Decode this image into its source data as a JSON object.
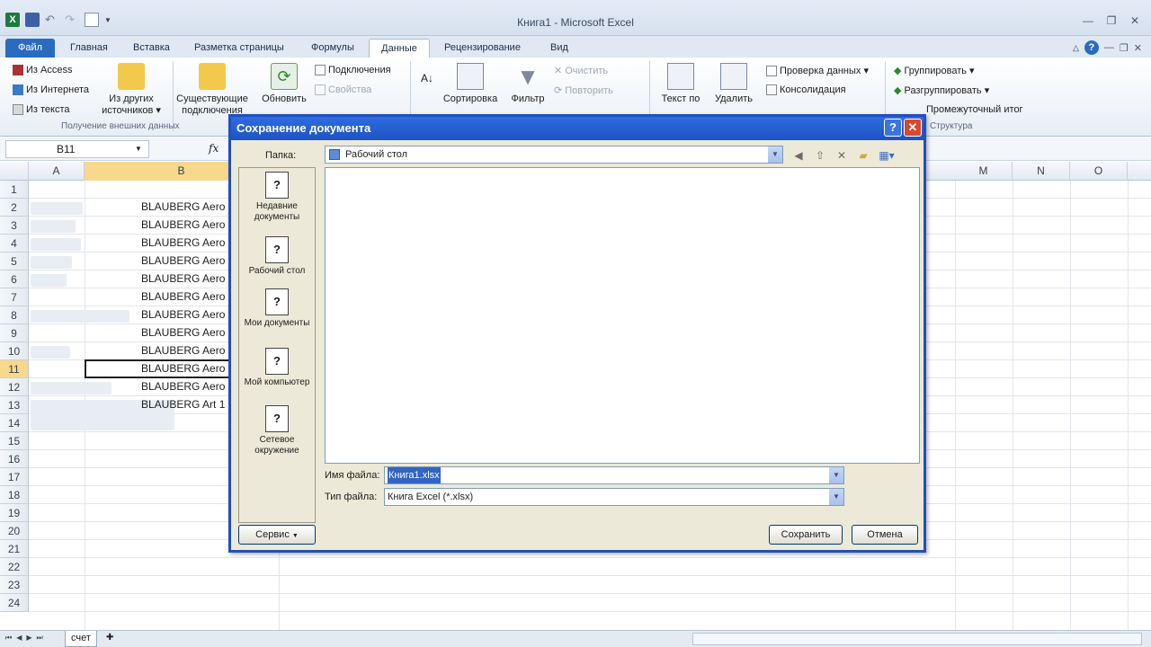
{
  "window": {
    "title": "Книга1 - Microsoft Excel"
  },
  "ribbon_tabs": [
    "Файл",
    "Главная",
    "Вставка",
    "Разметка страницы",
    "Формулы",
    "Данные",
    "Рецензирование",
    "Вид"
  ],
  "ribbon": {
    "from_access": "Из Access",
    "from_web": "Из Интернета",
    "from_text": "Из текста",
    "other_sources_l1": "Из других",
    "other_sources_l2": "источников ▾",
    "existing_l1": "Существующие",
    "existing_l2": "подключения",
    "refresh_l1": "Обновить",
    "connections": "Подключения",
    "properties": "Свойства",
    "sort": "Сортировка",
    "filter": "Фильтр",
    "clear": "Очистить",
    "reapply": "Повторить",
    "text_to_cols": "Текст по",
    "remove_dup": "Удалить",
    "data_validation": "Проверка данных ▾",
    "consolidate": "Консолидация",
    "group": "Группировать ▾",
    "ungroup": "Разгруппировать ▾",
    "subtotal": "Промежуточный итог",
    "group_external": "Получение внешних данных",
    "group_outline": "Структура"
  },
  "formula_bar": {
    "namebox": "B11",
    "fx": "fx"
  },
  "columns": [
    "A",
    "B",
    "M",
    "N",
    "O"
  ],
  "rows": [
    "1",
    "2",
    "3",
    "4",
    "5",
    "6",
    "7",
    "8",
    "9",
    "10",
    "11",
    "12",
    "13",
    "14",
    "15",
    "16",
    "17",
    "18",
    "19",
    "20",
    "21",
    "22",
    "23",
    "24"
  ],
  "cells": [
    "BLAUBERG Aero",
    "BLAUBERG Aero",
    "BLAUBERG Aero",
    "BLAUBERG Aero",
    "BLAUBERG Aero",
    "BLAUBERG Aero",
    "BLAUBERG Aero",
    "BLAUBERG Aero",
    "BLAUBERG Aero",
    "BLAUBERG Aero",
    "BLAUBERG Aero",
    "BLAUBERG Art 1"
  ],
  "sheet_tab": "счет",
  "dialog": {
    "title": "Сохранение документа",
    "folder_label": "Папка:",
    "folder_value": "Рабочий стол",
    "places": [
      "Недавние документы",
      "Рабочий стол",
      "Мои документы",
      "Мой компьютер",
      "Сетевое окружение"
    ],
    "filename_label": "Имя файла:",
    "filename_value": "Книга1.xlsx",
    "filetype_label": "Тип файла:",
    "filetype_value": "Книга Excel (*.xlsx)",
    "tools_button": "Сервис",
    "save_button": "Сохранить",
    "cancel_button": "Отмена"
  }
}
